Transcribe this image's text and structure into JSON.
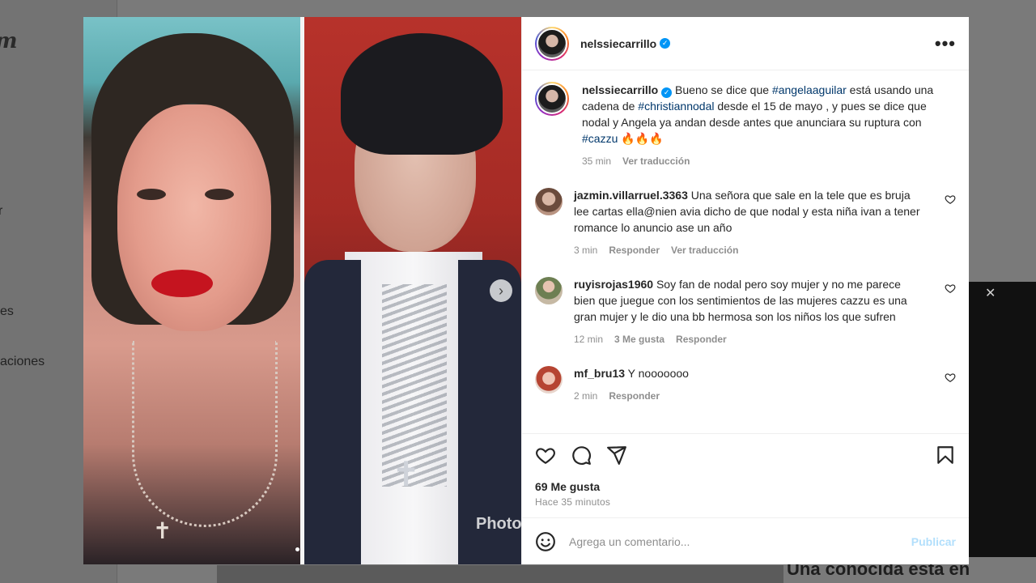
{
  "background": {
    "logo": "m",
    "nav_items": [
      "r",
      "es",
      "aciones"
    ],
    "bottom_title": "Una conocida esta en"
  },
  "post": {
    "username": "nelssiecarrillo",
    "verified": true,
    "watermark": "Photo",
    "caption": {
      "username": "nelssiecarrillo",
      "text_1": " Bueno se dice que ",
      "tag_1": "#angelaaguilar",
      "text_2": " está usando una cadena de ",
      "tag_2": "#christiannodal",
      "text_3": " desde el 15 de mayo , y pues se dice que nodal y Angela ya andan desde antes que anunciara su ruptura con ",
      "tag_3": "#cazzu",
      "emoji": " 🔥🔥🔥",
      "time": "35 min",
      "translate": "Ver traducción"
    },
    "comments": [
      {
        "username": "jazmin.villarruel.3363",
        "text": "Una señora que sale en la tele que es bruja lee cartas ella@nien avia dicho de que nodal y esta niña ivan a tener romance lo anuncio ase un año",
        "time": "3 min",
        "reply": "Responder",
        "translate": "Ver traducción"
      },
      {
        "username": "ruyisrojas1960",
        "text": "Soy fan de nodal pero soy mujer y no me parece bien que juegue con los sentimientos de las mujeres cazzu es una gran mujer y le dio una bb hermosa son los niños los que sufren",
        "time": "12 min",
        "likes": "3 Me gusta",
        "reply": "Responder"
      },
      {
        "username": "mf_bru13",
        "text": "Y nooooooo",
        "time": "2 min",
        "reply": "Responder"
      }
    ],
    "likes": "69 Me gusta",
    "time_ago": "Hace 35 minutos",
    "add_comment_placeholder": "Agrega un comentario...",
    "publish_label": "Publicar"
  },
  "colors": {
    "accent": "#0095f6",
    "hashtag": "#00376b",
    "muted": "#8e8e8e"
  },
  "icons": [
    "more-icon",
    "heart-icon",
    "comment-icon",
    "share-icon",
    "bookmark-icon",
    "emoji-icon",
    "chevron-right-icon",
    "verified-icon"
  ]
}
